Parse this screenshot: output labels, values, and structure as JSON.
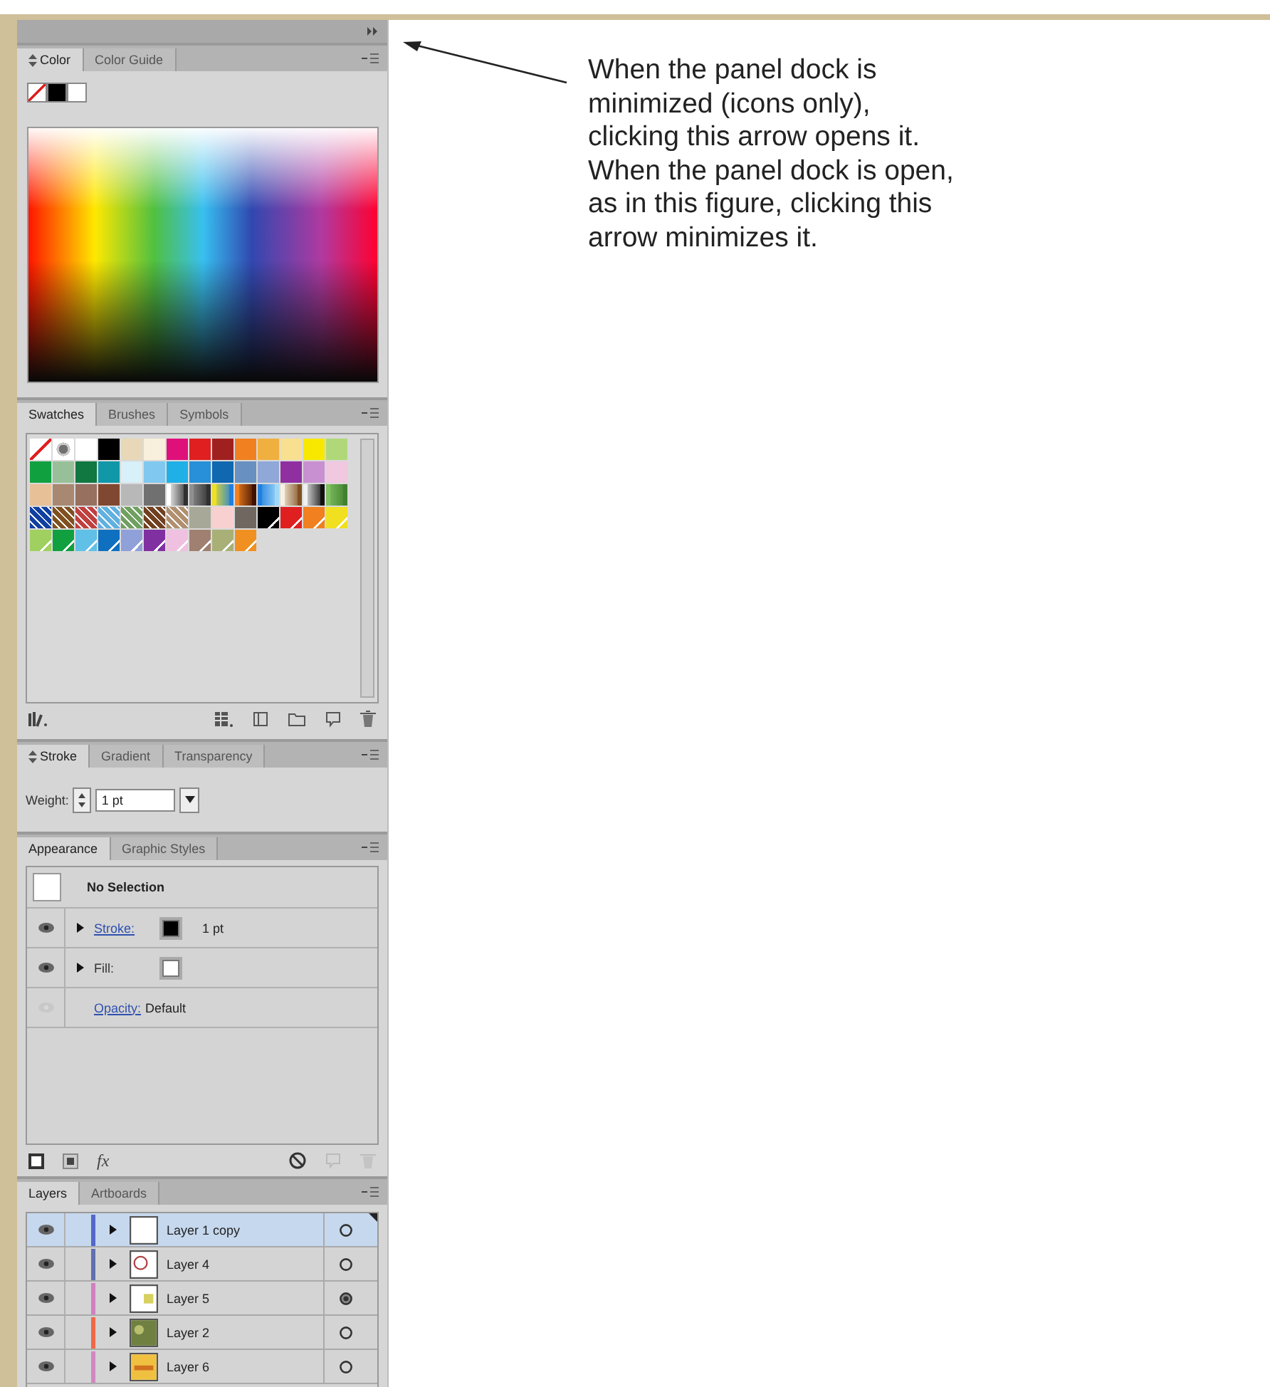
{
  "annotation": {
    "text": "When the panel dock is\nminimized (icons only),\nclicking this arrow opens it.\nWhen the panel dock is open,\nas in this figure, clicking this\narrow minimizes it."
  },
  "color_panel": {
    "show_options_icon": true,
    "tabs": [
      {
        "label": "Color",
        "selected": true
      },
      {
        "label": "Color Guide",
        "selected": false
      }
    ],
    "fill_stroke": [
      {
        "kind": "none"
      },
      {
        "kind": "solid",
        "color": "#000000"
      },
      {
        "kind": "solid",
        "color": "#ffffff"
      }
    ]
  },
  "swatches_panel": {
    "show_options_icon": false,
    "tabs": [
      {
        "label": "Swatches",
        "selected": true
      },
      {
        "label": "Brushes",
        "selected": false
      },
      {
        "label": "Symbols",
        "selected": false
      }
    ],
    "swatches": [
      {
        "kind": "none"
      },
      {
        "kind": "registration"
      },
      {
        "kind": "solid",
        "color": "#ffffff"
      },
      {
        "kind": "solid",
        "color": "#000000"
      },
      {
        "kind": "solid",
        "color": "#e8d8b8"
      },
      {
        "kind": "solid",
        "color": "#f8f0dc"
      },
      {
        "kind": "solid",
        "color": "#e0107a"
      },
      {
        "kind": "solid",
        "color": "#e02020"
      },
      {
        "kind": "solid",
        "color": "#a02020"
      },
      {
        "kind": "solid",
        "color": "#f08020"
      },
      {
        "kind": "solid",
        "color": "#f0b040"
      },
      {
        "kind": "solid",
        "color": "#f8e090"
      },
      {
        "kind": "solid",
        "color": "#f8e800"
      },
      {
        "kind": "solid",
        "color": "#b0d878"
      },
      {
        "kind": "solid",
        "color": "#10a040"
      },
      {
        "kind": "solid",
        "color": "#98c098"
      },
      {
        "kind": "solid",
        "color": "#107840"
      },
      {
        "kind": "solid",
        "color": "#1098a8"
      },
      {
        "kind": "solid",
        "color": "#d8f0f8"
      },
      {
        "kind": "solid",
        "color": "#80c8f0"
      },
      {
        "kind": "solid",
        "color": "#20b0e8"
      },
      {
        "kind": "solid",
        "color": "#2890d8"
      },
      {
        "kind": "solid",
        "color": "#1068b0"
      },
      {
        "kind": "solid",
        "color": "#6890c0"
      },
      {
        "kind": "solid",
        "color": "#90a8d8"
      },
      {
        "kind": "solid",
        "color": "#9030a0"
      },
      {
        "kind": "solid",
        "color": "#c890d0"
      },
      {
        "kind": "solid",
        "color": "#f0c8e0"
      },
      {
        "kind": "solid",
        "color": "#e8c098"
      },
      {
        "kind": "solid",
        "color": "#a88870"
      },
      {
        "kind": "solid",
        "color": "#987060"
      },
      {
        "kind": "solid",
        "color": "#804830"
      },
      {
        "kind": "solid",
        "color": "#b8b8b8"
      },
      {
        "kind": "solid",
        "color": "#707070"
      },
      {
        "kind": "gradient",
        "stops": [
          {
            "color": "#ffffff"
          },
          {
            "color": "#303030"
          }
        ]
      },
      {
        "kind": "gradient",
        "stops": [
          {
            "color": "#909090"
          },
          {
            "color": "#303030"
          }
        ]
      },
      {
        "kind": "gradient",
        "stops": [
          {
            "color": "#f0e020"
          },
          {
            "color": "#2080e0"
          }
        ]
      },
      {
        "kind": "gradient",
        "stops": [
          {
            "color": "#f08020"
          },
          {
            "color": "#401000"
          }
        ]
      },
      {
        "kind": "gradient",
        "stops": [
          {
            "color": "#2080e0"
          },
          {
            "color": "#a0d8f8"
          }
        ]
      },
      {
        "kind": "gradient",
        "stops": [
          {
            "color": "#f8f0e0"
          },
          {
            "color": "#805020"
          }
        ]
      },
      {
        "kind": "gradient",
        "stops": [
          {
            "color": "#f0f0f0"
          },
          {
            "color": "#101010"
          }
        ]
      },
      {
        "kind": "gradient",
        "stops": [
          {
            "color": "#80c060"
          },
          {
            "color": "#408030"
          }
        ]
      },
      {
        "kind": "pattern",
        "color": "#1040a0"
      },
      {
        "kind": "pattern",
        "color": "#805020"
      },
      {
        "kind": "pattern",
        "color": "#c04040"
      },
      {
        "kind": "pattern",
        "color": "#60b0e0"
      },
      {
        "kind": "pattern",
        "color": "#70a060"
      },
      {
        "kind": "pattern",
        "color": "#704020"
      },
      {
        "kind": "pattern",
        "color": "#b09070"
      },
      {
        "kind": "solid",
        "color": "#a8a898"
      },
      {
        "kind": "solid",
        "color": "#f8d0d0"
      },
      {
        "kind": "solid",
        "color": "#706860"
      },
      {
        "kind": "spot",
        "color": "#000000"
      },
      {
        "kind": "spot",
        "color": "#e02020"
      },
      {
        "kind": "spot",
        "color": "#f08020"
      },
      {
        "kind": "spot",
        "color": "#f0e020"
      },
      {
        "kind": "spot",
        "color": "#a0d060"
      },
      {
        "kind": "spot",
        "color": "#10a040"
      },
      {
        "kind": "spot",
        "color": "#60c0e8"
      },
      {
        "kind": "spot",
        "color": "#1070c0"
      },
      {
        "kind": "spot",
        "color": "#90a0d8"
      },
      {
        "kind": "spot",
        "color": "#8030a0"
      },
      {
        "kind": "spot",
        "color": "#f0c0e0"
      },
      {
        "kind": "spot",
        "color": "#a08070"
      },
      {
        "kind": "spot",
        "color": "#a8b078"
      },
      {
        "kind": "spot",
        "color": "#f09020"
      }
    ]
  },
  "stroke_panel": {
    "show_options_icon": true,
    "tabs": [
      {
        "label": "Stroke",
        "selected": true
      },
      {
        "label": "Gradient",
        "selected": false
      },
      {
        "label": "Transparency",
        "selected": false
      }
    ],
    "weight_label": "Weight:",
    "weight_value": "1 pt"
  },
  "appearance_panel": {
    "show_options_icon": false,
    "tabs": [
      {
        "label": "Appearance",
        "selected": true
      },
      {
        "label": "Graphic Styles",
        "selected": false
      }
    ],
    "rows": [
      {
        "kind": "header",
        "label": "No Selection"
      },
      {
        "kind": "attribute",
        "visible": true,
        "expandable": true,
        "label": "Stroke:",
        "link": true,
        "swatch": {
          "color": "#000000"
        },
        "value": "1 pt"
      },
      {
        "kind": "attribute",
        "visible": true,
        "expandable": true,
        "label": "Fill:",
        "link": false,
        "swatch": {
          "color": "#ffffff"
        }
      },
      {
        "kind": "attribute",
        "visible": false,
        "expandable": false,
        "label": "Opacity:",
        "link": true,
        "value": "Default"
      }
    ],
    "fx_label": "fx"
  },
  "layers_panel": {
    "show_options_icon": false,
    "tabs": [
      {
        "label": "Layers",
        "selected": true
      },
      {
        "label": "Artboards",
        "selected": false
      }
    ],
    "layers": [
      {
        "name": "Layer 1 copy",
        "selected": true,
        "color": "#5468c8",
        "targeted": false
      },
      {
        "name": "Layer 4",
        "selected": false,
        "color": "#6070b0",
        "targeted": false
      },
      {
        "name": "Layer 5",
        "selected": false,
        "color": "#d080c0",
        "targeted": true
      },
      {
        "name": "Layer 2",
        "selected": false,
        "color": "#f06848",
        "targeted": false
      },
      {
        "name": "Layer 6",
        "selected": false,
        "color": "#d088c0",
        "targeted": false
      }
    ]
  }
}
